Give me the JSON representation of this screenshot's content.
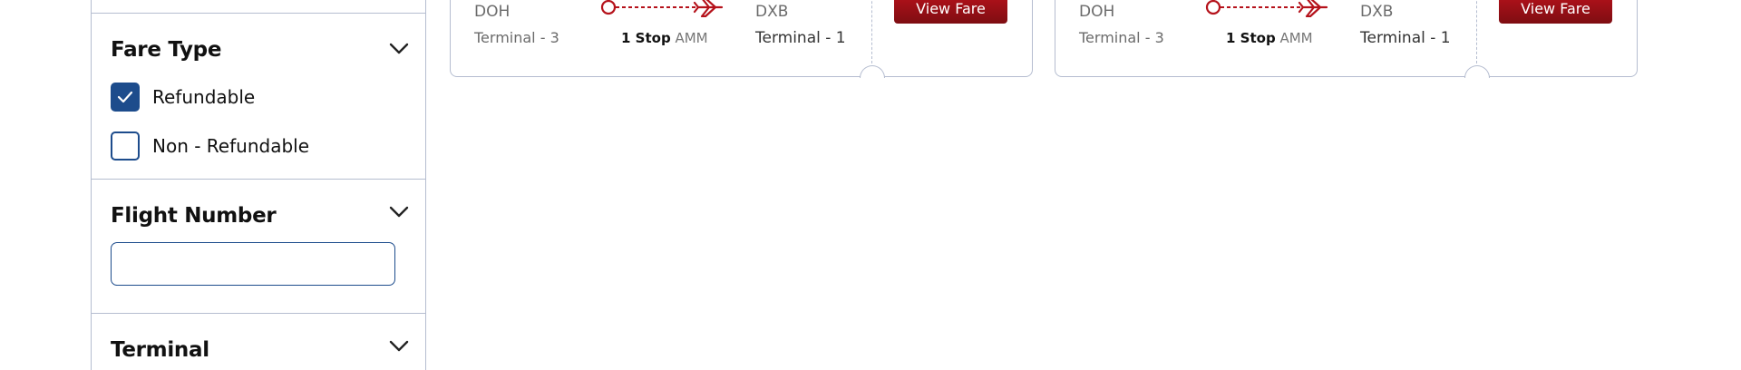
{
  "filters": {
    "fare_type": {
      "title": "Fare Type",
      "options": [
        {
          "label": "Refundable",
          "checked": true
        },
        {
          "label": "Non - Refundable",
          "checked": false
        }
      ]
    },
    "flight_number": {
      "title": "Flight Number",
      "value": "",
      "placeholder": ""
    },
    "terminal": {
      "title": "Terminal"
    }
  },
  "flights": [
    {
      "origin_code": "DOH",
      "origin_terminal": "Terminal - 3",
      "stops_label": "1 Stop",
      "via": "AMM",
      "dest_code": "DXB",
      "dest_terminal": "Terminal - 1",
      "cta": "View Fare"
    },
    {
      "origin_code": "DOH",
      "origin_terminal": "Terminal - 3",
      "stops_label": "1 Stop",
      "via": "AMM",
      "dest_code": "DXB",
      "dest_terminal": "Terminal - 1",
      "cta": "View Fare"
    }
  ],
  "colors": {
    "accent": "#b5121b",
    "checkbox": "#1d4c8c",
    "border": "#b5bdd0"
  }
}
